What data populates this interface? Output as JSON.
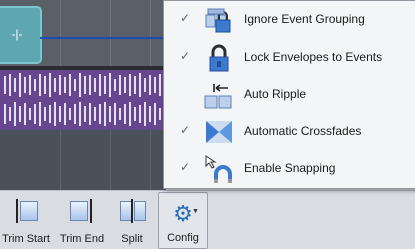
{
  "menu": {
    "items": [
      {
        "label": "Ignore Event Grouping",
        "checked": true,
        "icon": "group-lock-icon"
      },
      {
        "label": "Lock Envelopes to Events",
        "checked": true,
        "icon": "lock-icon"
      },
      {
        "label": "Auto Ripple",
        "checked": false,
        "icon": "auto-ripple-icon"
      },
      {
        "label": "Automatic Crossfades",
        "checked": true,
        "icon": "crossfade-icon"
      },
      {
        "label": "Enable Snapping",
        "checked": true,
        "icon": "snap-magnet-icon"
      }
    ],
    "check_glyph": "✓"
  },
  "toolbar": {
    "trim_start_label": "Trim Start",
    "trim_end_label": "Trim End",
    "split_label": "Split",
    "config_label": "Config"
  },
  "colors": {
    "audio_event": "#66468f",
    "video_event": "#5fa7b0",
    "envelope": "#1e4ab5",
    "accent": "#2b6fb6"
  }
}
